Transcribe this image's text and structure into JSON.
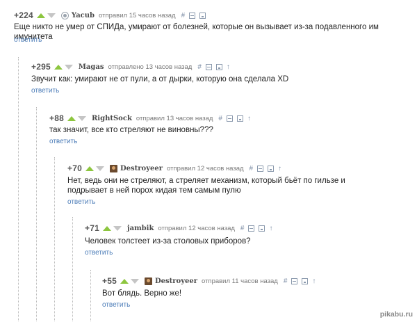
{
  "comments": [
    {
      "rating": "+224",
      "author": "Yacub",
      "time": "отправил 15 часов назад",
      "text": "Еще никто не умер от СПИДа, умирают от болезней, которые он вызывает из-за подавленного им имунитета",
      "reply": "ответить",
      "hash": "#",
      "avatar": "user-avatar-icon"
    },
    {
      "rating": "+295",
      "author": "Magas",
      "time": "отправлено 13 часов назад",
      "text": "Звучит как: умирают не от пули, а от дырки, которую она сделала XD",
      "reply": "ответить",
      "hash": "#",
      "parent_arrow": "↑"
    },
    {
      "rating": "+88",
      "author": "RightSock",
      "time": "отправил 13 часов назад",
      "text": "так значит, все кто стреляют не виновны???",
      "reply": "ответить",
      "hash": "#",
      "parent_arrow": "↑"
    },
    {
      "rating": "+70",
      "author": "Destroyeer",
      "time": "отправил 12 часов назад",
      "text": "Нет, ведь они не стреляют, а стреляет механизм, который бьёт по гильзе и подрывает в ней порох кидая тем самым пулю",
      "reply": "ответить",
      "hash": "#",
      "parent_arrow": "↑",
      "avatar": "destroyeer-avatar-image"
    },
    {
      "rating": "+71",
      "author": "jambik",
      "time": "отправил 12 часов назад",
      "text": "Человек толстеет из-за столовых приборов?",
      "reply": "ответить",
      "hash": "#",
      "parent_arrow": "↑"
    },
    {
      "rating": "+55",
      "author": "Destroyeer",
      "time": "отправил 11 часов назад",
      "text": "Вот блядь. Верно же!",
      "reply": "ответить",
      "hash": "#",
      "parent_arrow": "↑",
      "avatar": "destroyeer-avatar-image"
    }
  ],
  "colors": {
    "upvote": "#8dc63f",
    "downvote": "#c5c5c5",
    "link": "#4a7bb7",
    "thread_line": "#b9b9b9"
  },
  "watermark": "pikabu.ru"
}
